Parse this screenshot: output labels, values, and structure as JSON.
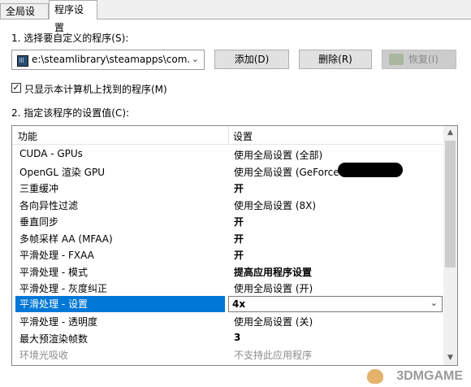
{
  "tabs": [
    {
      "label": "全局设置"
    },
    {
      "label": "程序设置"
    }
  ],
  "section1": {
    "label": "1. 选择要自定义的程序(S):",
    "program_value": "e:\\steamlibrary\\steamapps\\com...",
    "add_label": "添加(D)",
    "delete_label": "删除(R)",
    "restore_label": "恢复(I)"
  },
  "filter": {
    "checked": true,
    "check_glyph": "✓",
    "label": "只显示本计算机上找到的程序(M)"
  },
  "section2": {
    "label": "2. 指定该程序的设置值(C):"
  },
  "grid": {
    "columns": [
      "功能",
      "设置"
    ],
    "rows": [
      {
        "feature": "CUDA - GPUs",
        "setting": "使用全局设置 (全部)",
        "bold": false
      },
      {
        "feature": "OpenGL 渲染 GPU",
        "setting": "使用全局设置 (GeForce",
        "bold": false
      },
      {
        "feature": "三重缓冲",
        "setting": "开",
        "bold": true
      },
      {
        "feature": "各向异性过滤",
        "setting": "使用全局设置 (8X)",
        "bold": false
      },
      {
        "feature": "垂直同步",
        "setting": "开",
        "bold": true
      },
      {
        "feature": "多帧采样 AA (MFAA)",
        "setting": "开",
        "bold": true
      },
      {
        "feature": "平滑处理 - FXAA",
        "setting": "开",
        "bold": true
      },
      {
        "feature": "平滑处理 - 模式",
        "setting": "提高应用程序设置",
        "bold": true
      },
      {
        "feature": "平滑处理 - 灰度纠正",
        "setting": "使用全局设置 (开)",
        "bold": false
      },
      {
        "feature": "平滑处理 - 设置",
        "setting": "4x",
        "bold": true,
        "selected": true
      },
      {
        "feature": "平滑处理 - 透明度",
        "setting": "使用全局设置 (关)",
        "bold": false
      },
      {
        "feature": "最大预渲染帧数",
        "setting": "3",
        "bold": true
      },
      {
        "feature": "环境光吸收",
        "setting": "不支持此应用程序",
        "bold": false,
        "disabled": true
      }
    ]
  },
  "watermark": {
    "text": "3DMGAME"
  },
  "colors": {
    "selection": "#0078d7",
    "window_bg": "#f0f0f0"
  }
}
